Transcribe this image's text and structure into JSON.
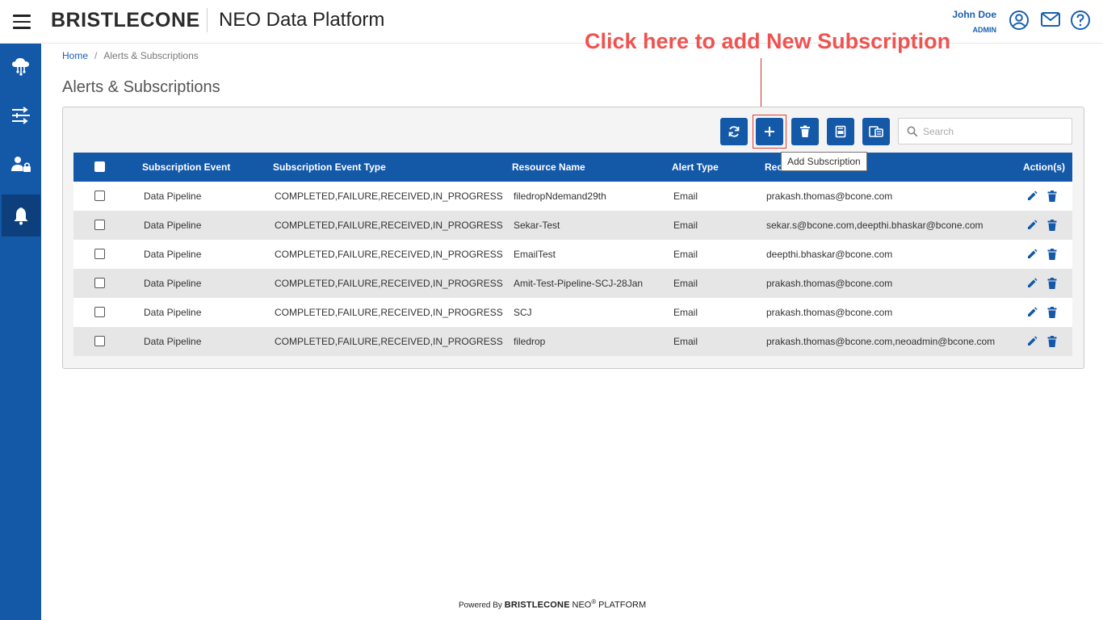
{
  "header": {
    "logo": "BRISTLECONE",
    "app_title": "NEO Data Platform",
    "user_name": "John Doe",
    "user_role": "ADMIN"
  },
  "breadcrumb": {
    "home": "Home",
    "separator": "/",
    "current": "Alerts & Subscriptions"
  },
  "page_title": "Alerts & Subscriptions",
  "annotation": "Click here to add New Subscription",
  "toolbar": {
    "tooltip": "Add Subscription",
    "search_placeholder": "Search"
  },
  "table": {
    "columns": [
      "Subscription Event",
      "Subscription Event Type",
      "Resource Name",
      "Alert Type",
      "Rec",
      "Action(s)"
    ],
    "rows": [
      {
        "event": "Data Pipeline",
        "event_type": "COMPLETED,FAILURE,RECEIVED,IN_PROGRESS",
        "resource": "filedropNdemand29th",
        "alert_type": "Email",
        "recipients": "prakash.thomas@bcone.com"
      },
      {
        "event": "Data Pipeline",
        "event_type": "COMPLETED,FAILURE,RECEIVED,IN_PROGRESS",
        "resource": "Sekar-Test",
        "alert_type": "Email",
        "recipients": "sekar.s@bcone.com,deepthi.bhaskar@bcone.com"
      },
      {
        "event": "Data Pipeline",
        "event_type": "COMPLETED,FAILURE,RECEIVED,IN_PROGRESS",
        "resource": "EmailTest",
        "alert_type": "Email",
        "recipients": "deepthi.bhaskar@bcone.com"
      },
      {
        "event": "Data Pipeline",
        "event_type": "COMPLETED,FAILURE,RECEIVED,IN_PROGRESS",
        "resource": "Amit-Test-Pipeline-SCJ-28Jan",
        "alert_type": "Email",
        "recipients": "prakash.thomas@bcone.com"
      },
      {
        "event": "Data Pipeline",
        "event_type": "COMPLETED,FAILURE,RECEIVED,IN_PROGRESS",
        "resource": "SCJ",
        "alert_type": "Email",
        "recipients": "prakash.thomas@bcone.com"
      },
      {
        "event": "Data Pipeline",
        "event_type": "COMPLETED,FAILURE,RECEIVED,IN_PROGRESS",
        "resource": "filedrop",
        "alert_type": "Email",
        "recipients": "prakash.thomas@bcone.com,neoadmin@bcone.com"
      }
    ]
  },
  "footer": {
    "powered_by": "Powered By",
    "brand": "BRISTLECONE",
    "neo": "NEO",
    "registered": "®",
    "platform": "PLATFORM"
  },
  "colors": {
    "primary": "#1458a8",
    "sidebar_active": "#0e3f7d",
    "annotation": "#ef5350",
    "row_alt": "#e6e6e6"
  },
  "icons": {
    "menu": "hamburger-icon",
    "user": "user-circle-icon",
    "mail": "mail-icon",
    "help": "help-icon",
    "sidebar": [
      "cloud-network-icon",
      "pipeline-transform-icon",
      "user-admin-icon",
      "bell-icon"
    ],
    "toolbar": [
      "refresh-icon",
      "plus-icon",
      "trash-icon",
      "export-icon",
      "copy-icon"
    ],
    "row_actions": [
      "edit-icon",
      "delete-icon"
    ]
  }
}
